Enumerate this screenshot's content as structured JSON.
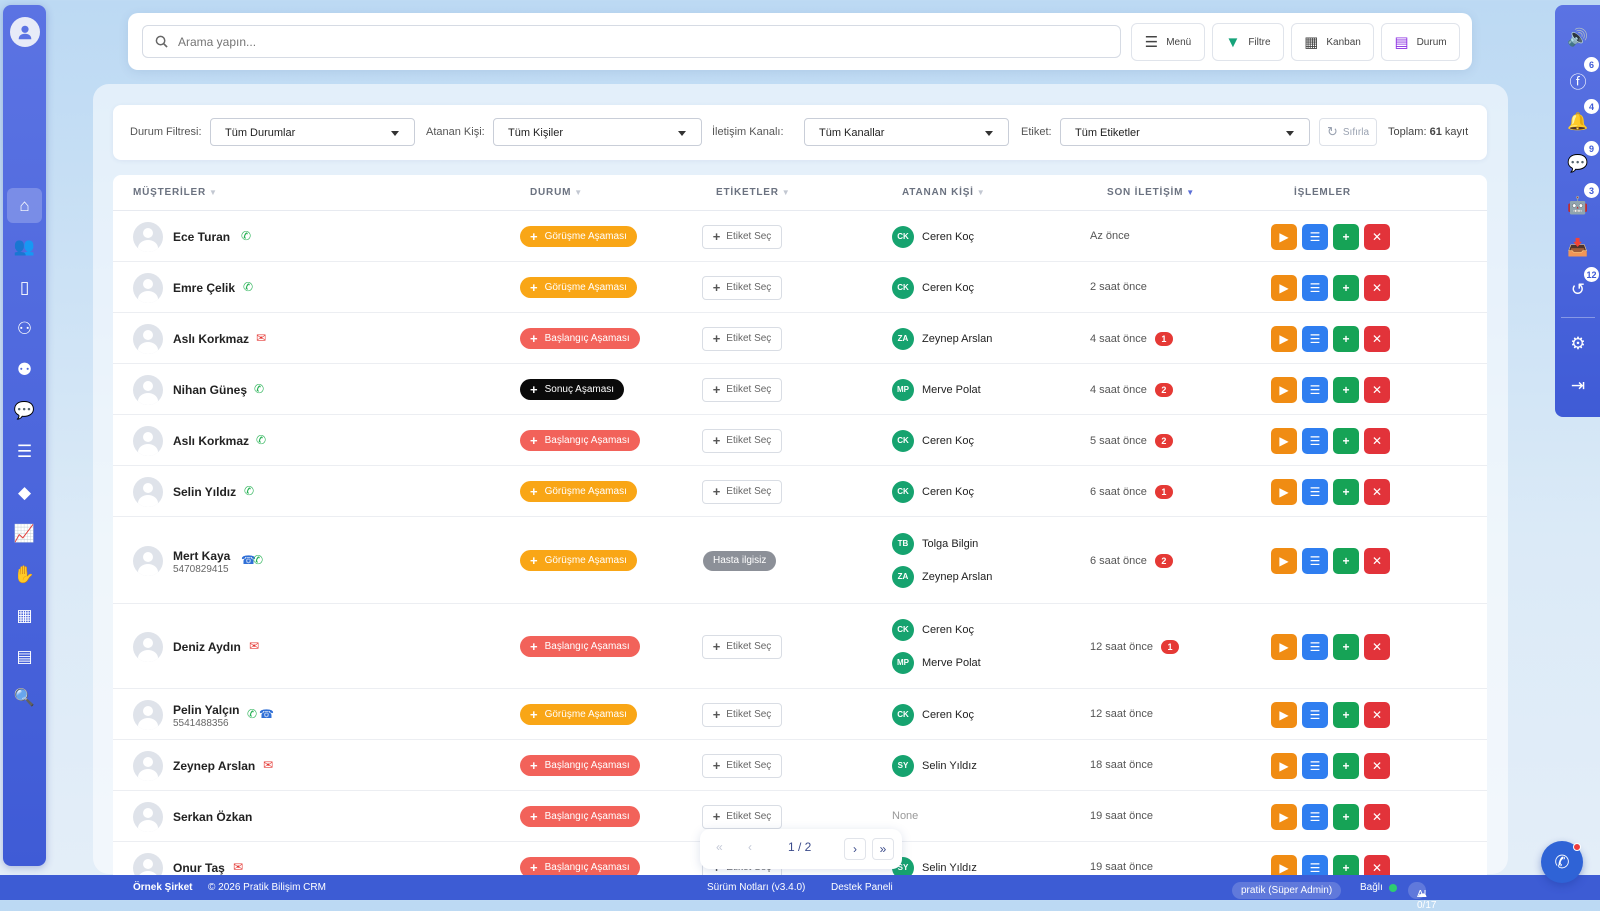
{
  "search": {
    "placeholder": "Arama yapın..."
  },
  "toolbar": {
    "menu": "Menü",
    "filter": "Filtre",
    "kanban": "Kanban",
    "status": "Durum"
  },
  "filters": {
    "status_label": "Durum Filtresi:",
    "status_value": "Tüm Durumlar",
    "assignee_label": "Atanan Kişi:",
    "assignee_value": "Tüm Kişiler",
    "channel_label": "İletişim Kanalı:",
    "channel_value": "Tüm Kanallar",
    "tag_label": "Etiket:",
    "tag_value": "Tüm Etiketler",
    "reset": "Sıfırla",
    "total_label": "Toplam:",
    "total_value": "61",
    "total_suffix": "kayıt"
  },
  "columns": {
    "customers": "MÜŞTERİLER",
    "status": "DURUM",
    "tags": "ETİKETLER",
    "assignee": "ATANAN KİŞİ",
    "last_contact": "SON İLETİŞİM",
    "actions": "İŞLEMLER"
  },
  "tag_button": "Etiket Seç",
  "rows": [
    {
      "name": "Ece Turan",
      "status": "Görüşme Aşaması",
      "assignees": [
        {
          "ini": "CK",
          "name": "Ceren Koç"
        }
      ],
      "last": "Az önce",
      "count": ""
    },
    {
      "name": "Emre Çelik",
      "status": "Görüşme Aşaması",
      "assignees": [
        {
          "ini": "CK",
          "name": "Ceren Koç"
        }
      ],
      "last": "2 saat önce",
      "count": ""
    },
    {
      "name": "Aslı Korkmaz",
      "status": "Başlangıç Aşaması",
      "assignees": [
        {
          "ini": "ZA",
          "name": "Zeynep Arslan"
        }
      ],
      "last": "4 saat önce",
      "count": "1"
    },
    {
      "name": "Nihan Güneş",
      "status": "Sonuç Aşaması",
      "assignees": [
        {
          "ini": "MP",
          "name": "Merve Polat"
        }
      ],
      "last": "4 saat önce",
      "count": "2"
    },
    {
      "name": "Aslı Korkmaz",
      "status": "Başlangıç Aşaması",
      "assignees": [
        {
          "ini": "CK",
          "name": "Ceren Koç"
        }
      ],
      "last": "5 saat önce",
      "count": "2"
    },
    {
      "name": "Selin Yıldız",
      "status": "Görüşme Aşaması",
      "assignees": [
        {
          "ini": "CK",
          "name": "Ceren Koç"
        }
      ],
      "last": "6 saat önce",
      "count": "1"
    },
    {
      "name": "Mert Kaya",
      "phone": "5470829415",
      "status": "Görüşme Aşaması",
      "tag": "Hasta ilgisiz",
      "assignees": [
        {
          "ini": "TB",
          "name": "Tolga Bilgin"
        },
        {
          "ini": "ZA",
          "name": "Zeynep Arslan"
        }
      ],
      "last": "6 saat önce",
      "count": "2"
    },
    {
      "name": "Deniz Aydın",
      "status": "Başlangıç Aşaması",
      "assignees": [
        {
          "ini": "CK",
          "name": "Ceren Koç"
        },
        {
          "ini": "MP",
          "name": "Merve Polat"
        }
      ],
      "last": "12 saat önce",
      "count": "1"
    },
    {
      "name": "Pelin Yalçın",
      "phone": "5541488356",
      "status": "Görüşme Aşaması",
      "assignees": [
        {
          "ini": "CK",
          "name": "Ceren Koç"
        }
      ],
      "last": "12 saat önce",
      "count": ""
    },
    {
      "name": "Zeynep Arslan",
      "status": "Başlangıç Aşaması",
      "assignees": [
        {
          "ini": "SY",
          "name": "Selin Yıldız"
        }
      ],
      "last": "18 saat önce",
      "count": ""
    },
    {
      "name": "Serkan Özkan",
      "status": "Başlangıç Aşaması",
      "assignees": [],
      "none": "None",
      "last": "19 saat önce",
      "count": ""
    },
    {
      "name": "Onur Taş",
      "status": "Başlangıç Aşaması",
      "assignees": [
        {
          "ini": "SY",
          "name": "Selin Yıldız"
        }
      ],
      "last": "19 saat önce",
      "count": ""
    }
  ],
  "pager": {
    "label": "1 / 2"
  },
  "footer": {
    "company": "Örnek Şirket",
    "copyright": "© 2026 Pratik Bilişim CRM",
    "release": "Sürüm Notları (v3.4.0)",
    "support": "Destek Paneli",
    "user": "pratik (Süper Admin)",
    "connection": "Bağlı",
    "ai": "AI 0/17"
  },
  "right_badges": {
    "facebook": "6",
    "bell": "4",
    "chat": "9",
    "bot": "3",
    "history": "12"
  }
}
